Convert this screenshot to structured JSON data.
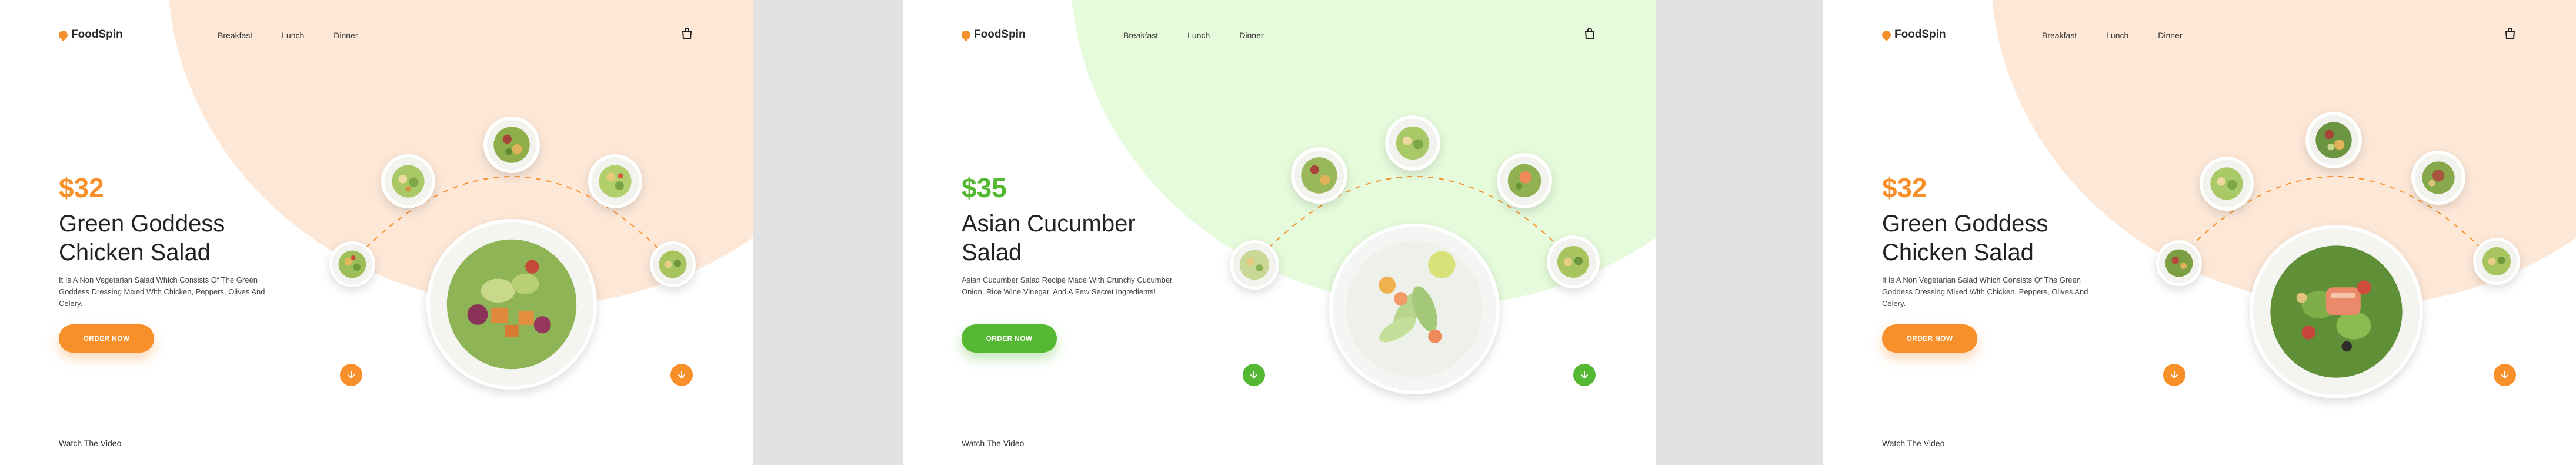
{
  "panels": [
    {
      "brand": "FoodSpin",
      "nav": [
        "Breakfast",
        "Lunch",
        "Dinner"
      ],
      "price": "$32",
      "title": "Green Goddess Chicken Salad",
      "description": "It Is A Non Vegetarian Salad Which Consists Of The Green Goddess Dressing Mixed With Chicken, Peppers, Olives And Celery.",
      "cta": "ORDER NOW",
      "video_link": "Watch The Video",
      "accent": "#f7902a",
      "bg_tint": "#fde8d8"
    },
    {
      "brand": "FoodSpin",
      "nav": [
        "Breakfast",
        "Lunch",
        "Dinner"
      ],
      "price": "$35",
      "title": "Asian Cucumber Salad",
      "description": "Asian Cucumber Salad Recipe Made With Crunchy Cucumber, Onion, Rice Wine Vinegar, And A Few Secret Ingredients!",
      "cta": "ORDER NOW",
      "video_link": "Watch The Video",
      "accent": "#55b832",
      "bg_tint": "#e6fbdc"
    },
    {
      "brand": "FoodSpin",
      "nav": [
        "Breakfast",
        "Lunch",
        "Dinner"
      ],
      "price": "$32",
      "title": "Green Goddess Chicken Salad",
      "description": "It Is A Non Vegetarian Salad Which Consists Of The Green Goddess Dressing Mixed With Chicken, Peppers, Olives And Celery.",
      "cta": "ORDER NOW",
      "video_link": "Watch The Video",
      "accent": "#f7902a",
      "bg_tint": "#fde8d8"
    }
  ],
  "icons": {
    "logo": "leaf-flame-icon",
    "cart": "shopping-bag-icon",
    "prev": "arrow-down-icon",
    "next": "arrow-down-icon"
  }
}
